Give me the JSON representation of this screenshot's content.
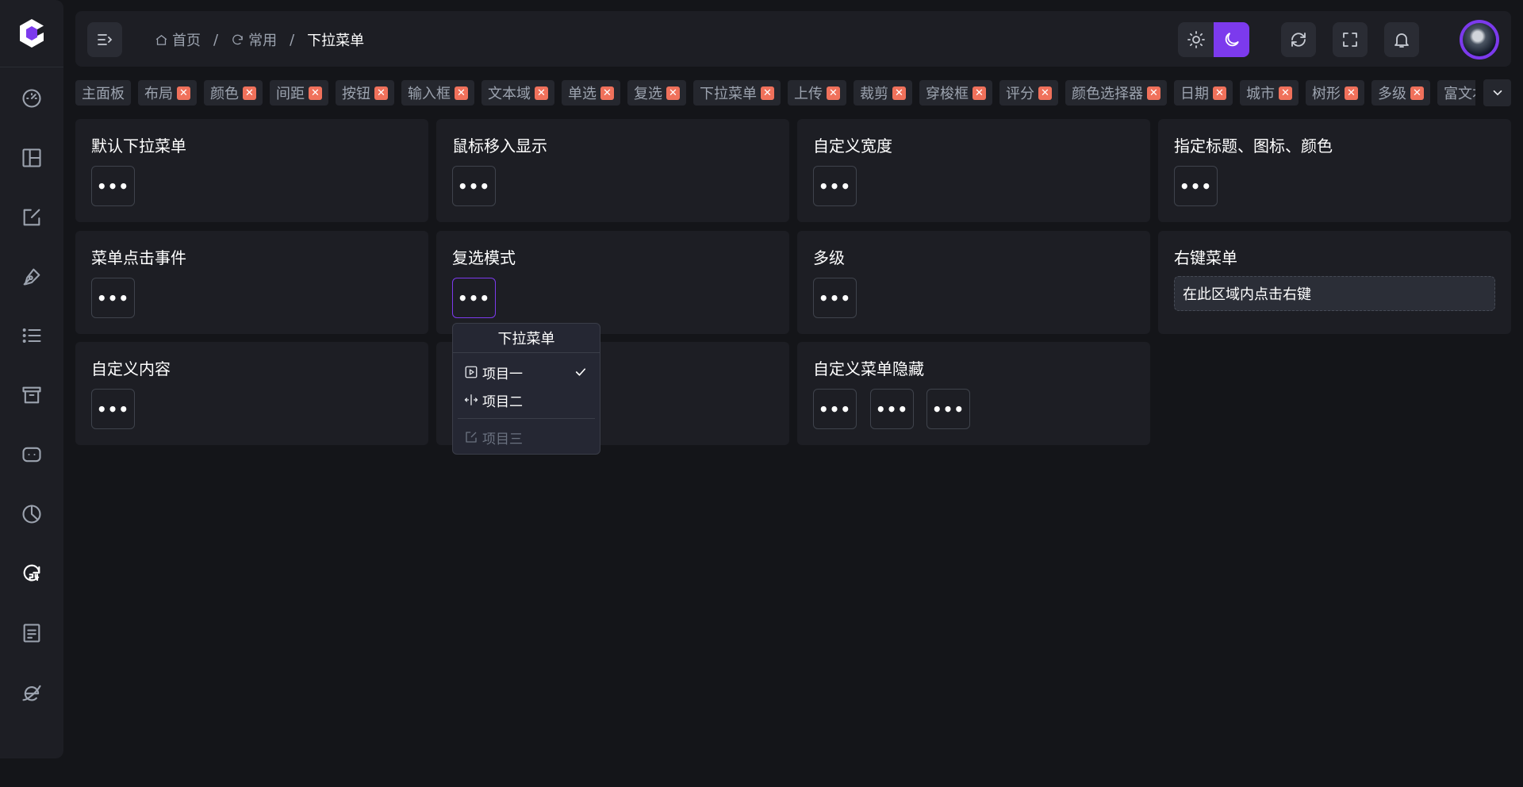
{
  "header": {
    "breadcrumb": [
      {
        "label": "首页",
        "icon": "home-icon"
      },
      {
        "label": "常用",
        "icon": "clock-24-icon"
      },
      {
        "label": "下拉菜单",
        "icon": ""
      }
    ],
    "separator": "/",
    "theme_mode": "dark"
  },
  "tabs": {
    "items": [
      {
        "label": "主面板",
        "closable": false
      },
      {
        "label": "布局",
        "closable": true
      },
      {
        "label": "颜色",
        "closable": true
      },
      {
        "label": "间距",
        "closable": true
      },
      {
        "label": "按钮",
        "closable": true
      },
      {
        "label": "输入框",
        "closable": true
      },
      {
        "label": "文本域",
        "closable": true
      },
      {
        "label": "单选",
        "closable": true
      },
      {
        "label": "复选",
        "closable": true
      },
      {
        "label": "下拉菜单",
        "closable": true
      },
      {
        "label": "上传",
        "closable": true
      },
      {
        "label": "裁剪",
        "closable": true
      },
      {
        "label": "穿梭框",
        "closable": true
      },
      {
        "label": "评分",
        "closable": true
      },
      {
        "label": "颜色选择器",
        "closable": true
      },
      {
        "label": "日期",
        "closable": true
      },
      {
        "label": "城市",
        "closable": true
      },
      {
        "label": "树形",
        "closable": true
      },
      {
        "label": "多级",
        "closable": true
      },
      {
        "label": "富文本",
        "closable": false
      }
    ],
    "close_glyph": "✕"
  },
  "cards": [
    {
      "title": "默认下拉菜单"
    },
    {
      "title": "鼠标移入显示"
    },
    {
      "title": "自定义宽度"
    },
    {
      "title": "指定标题、图标、颜色"
    },
    {
      "title": "菜单点击事件"
    },
    {
      "title": "复选模式"
    },
    {
      "title": "多级"
    },
    {
      "title": "右键菜单",
      "area_text": "在此区域内点击右键"
    },
    {
      "title": "自定义内容"
    },
    {
      "title": "自定义菜单隐藏"
    }
  ],
  "button_glyph": "•••",
  "dropdown": {
    "title": "下拉菜单",
    "items": [
      {
        "label": "项目一",
        "icon": "play-square-icon",
        "checked": true,
        "disabled": false
      },
      {
        "label": "项目二",
        "icon": "split-arrows-icon",
        "checked": false,
        "disabled": false
      },
      {
        "label": "项目三",
        "icon": "edit-icon",
        "checked": false,
        "disabled": true
      }
    ]
  },
  "colors": {
    "accent": "#7c3aed",
    "background": "#141519",
    "panel": "#1d1e24",
    "close_badge": "#f0715b"
  }
}
